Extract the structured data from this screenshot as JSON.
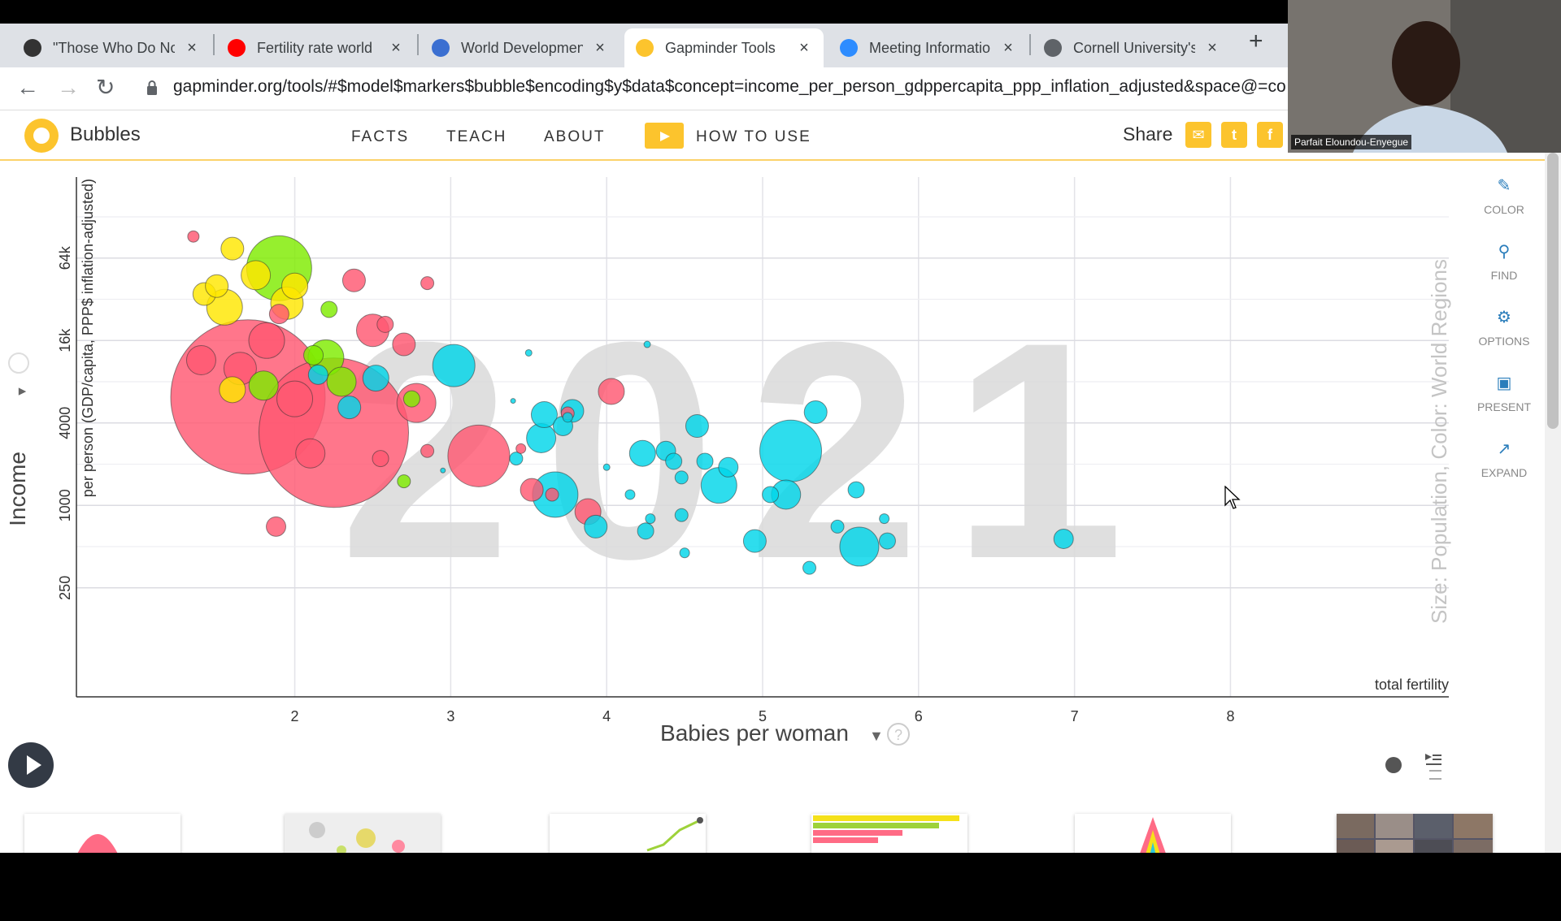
{
  "browser": {
    "tabs": [
      {
        "title": "\"Those Who Do No",
        "favicon": "document-icon",
        "color": "#333333"
      },
      {
        "title": "Fertility rate world",
        "favicon": "youtube-icon",
        "color": "#ff0000"
      },
      {
        "title": "World Developmen",
        "favicon": "globe-icon",
        "color": "#3b6fd1"
      },
      {
        "title": "Gapminder Tools",
        "favicon": "gapminder-icon",
        "color": "#fcc42d"
      },
      {
        "title": "Meeting Informatio",
        "favicon": "zoom-icon",
        "color": "#2d8cff"
      },
      {
        "title": "Cornell University's",
        "favicon": "globe-icon",
        "color": "#5f6368"
      }
    ],
    "active_tab": 3,
    "url": "gapminder.org/tools/#$model$markers$bubble$encoding$y$data$concept=income_per_person_gdppercapita_ppp_inflation_adjusted&space@=co"
  },
  "app": {
    "name": "Bubbles",
    "menu": [
      "FACTS",
      "TEACH",
      "ABOUT"
    ],
    "how_to_use": "HOW TO USE",
    "share": "Share",
    "brand_color": "#fcc42d"
  },
  "video": {
    "participant": "Parfait Eloundou-Enyegue"
  },
  "tools": [
    "COLOR",
    "FIND",
    "OPTIONS",
    "PRESENT",
    "EXPAND"
  ],
  "chart_data": {
    "type": "scatter",
    "year": "2021",
    "xlabel": "Babies per woman",
    "xlabel_corner": "total fertility",
    "ylabel": "Income",
    "ylabel_sub": "per person (GDP/capita, PPP$ inflation-adjusted)",
    "size_color_label": "Size: Population, Color: World Regions",
    "x_ticks": [
      2,
      3,
      4,
      5,
      6,
      7,
      8
    ],
    "y_ticks": [
      {
        "label": "250",
        "value": 250
      },
      {
        "label": "1000",
        "value": 1000
      },
      {
        "label": "4000",
        "value": 4000
      },
      {
        "label": "16k",
        "value": 16000
      },
      {
        "label": "64k",
        "value": 64000
      }
    ],
    "xlim": [
      0.6,
      9.4
    ],
    "ylim": [
      40,
      250000
    ],
    "y_scale": "log",
    "grid": true,
    "colors": {
      "asia": "#ff5872",
      "africa": "#00d5e9",
      "americas": "#7feb00",
      "europe": "#ffe700"
    },
    "points": [
      {
        "x": 1.7,
        "y": 6200,
        "r": 95,
        "region": "asia"
      },
      {
        "x": 2.25,
        "y": 3400,
        "r": 92,
        "region": "asia"
      },
      {
        "x": 5.18,
        "y": 2500,
        "r": 38,
        "region": "africa"
      },
      {
        "x": 1.9,
        "y": 54000,
        "r": 40,
        "region": "americas"
      },
      {
        "x": 3.18,
        "y": 2300,
        "r": 38,
        "region": "asia"
      },
      {
        "x": 3.02,
        "y": 10500,
        "r": 26,
        "region": "africa"
      },
      {
        "x": 3.67,
        "y": 1200,
        "r": 28,
        "region": "africa"
      },
      {
        "x": 4.72,
        "y": 1400,
        "r": 22,
        "region": "africa"
      },
      {
        "x": 5.62,
        "y": 500,
        "r": 24,
        "region": "africa"
      },
      {
        "x": 2.78,
        "y": 5600,
        "r": 24,
        "region": "asia"
      },
      {
        "x": 1.55,
        "y": 28000,
        "r": 22,
        "region": "europe"
      },
      {
        "x": 1.82,
        "y": 16000,
        "r": 22,
        "region": "asia"
      },
      {
        "x": 2.5,
        "y": 19000,
        "r": 20,
        "region": "asia"
      },
      {
        "x": 1.95,
        "y": 30000,
        "r": 20,
        "region": "europe"
      },
      {
        "x": 2.2,
        "y": 12000,
        "r": 22,
        "region": "americas"
      },
      {
        "x": 2.0,
        "y": 6000,
        "r": 22,
        "region": "asia"
      },
      {
        "x": 2.1,
        "y": 2400,
        "r": 18,
        "region": "asia"
      },
      {
        "x": 1.65,
        "y": 10000,
        "r": 20,
        "region": "asia"
      },
      {
        "x": 1.4,
        "y": 11500,
        "r": 18,
        "region": "asia"
      },
      {
        "x": 2.3,
        "y": 8000,
        "r": 18,
        "region": "americas"
      },
      {
        "x": 2.52,
        "y": 8500,
        "r": 16,
        "region": "africa"
      },
      {
        "x": 2.7,
        "y": 15000,
        "r": 14,
        "region": "asia"
      },
      {
        "x": 2.38,
        "y": 44000,
        "r": 14,
        "region": "asia"
      },
      {
        "x": 2.58,
        "y": 21000,
        "r": 10,
        "region": "asia"
      },
      {
        "x": 2.85,
        "y": 42000,
        "r": 8,
        "region": "asia"
      },
      {
        "x": 1.35,
        "y": 92000,
        "r": 7,
        "region": "asia"
      },
      {
        "x": 1.6,
        "y": 75000,
        "r": 14,
        "region": "europe"
      },
      {
        "x": 1.75,
        "y": 48000,
        "r": 18,
        "region": "europe"
      },
      {
        "x": 2.0,
        "y": 40000,
        "r": 16,
        "region": "europe"
      },
      {
        "x": 1.42,
        "y": 35000,
        "r": 14,
        "region": "europe"
      },
      {
        "x": 1.6,
        "y": 7000,
        "r": 16,
        "region": "europe"
      },
      {
        "x": 1.8,
        "y": 7500,
        "r": 18,
        "region": "americas"
      },
      {
        "x": 2.12,
        "y": 12500,
        "r": 12,
        "region": "americas"
      },
      {
        "x": 1.5,
        "y": 40000,
        "r": 14,
        "region": "europe"
      },
      {
        "x": 2.22,
        "y": 27000,
        "r": 10,
        "region": "americas"
      },
      {
        "x": 2.15,
        "y": 9000,
        "r": 12,
        "region": "africa"
      },
      {
        "x": 2.35,
        "y": 5200,
        "r": 14,
        "region": "africa"
      },
      {
        "x": 1.9,
        "y": 25000,
        "r": 12,
        "region": "asia"
      },
      {
        "x": 2.75,
        "y": 6000,
        "r": 10,
        "region": "americas"
      },
      {
        "x": 2.55,
        "y": 2200,
        "r": 10,
        "region": "asia"
      },
      {
        "x": 2.85,
        "y": 2500,
        "r": 8,
        "region": "asia"
      },
      {
        "x": 2.7,
        "y": 1500,
        "r": 8,
        "region": "americas"
      },
      {
        "x": 1.88,
        "y": 700,
        "r": 12,
        "region": "asia"
      },
      {
        "x": 3.42,
        "y": 2200,
        "r": 8,
        "region": "africa"
      },
      {
        "x": 3.5,
        "y": 13000,
        "r": 4,
        "region": "africa"
      },
      {
        "x": 3.58,
        "y": 3100,
        "r": 18,
        "region": "africa"
      },
      {
        "x": 3.72,
        "y": 3800,
        "r": 12,
        "region": "africa"
      },
      {
        "x": 3.52,
        "y": 1300,
        "r": 14,
        "region": "asia"
      },
      {
        "x": 3.88,
        "y": 900,
        "r": 16,
        "region": "asia"
      },
      {
        "x": 3.93,
        "y": 700,
        "r": 14,
        "region": "africa"
      },
      {
        "x": 4.03,
        "y": 6800,
        "r": 16,
        "region": "asia"
      },
      {
        "x": 4.23,
        "y": 2400,
        "r": 16,
        "region": "africa"
      },
      {
        "x": 4.38,
        "y": 2500,
        "r": 12,
        "region": "africa"
      },
      {
        "x": 4.43,
        "y": 2100,
        "r": 10,
        "region": "africa"
      },
      {
        "x": 4.58,
        "y": 3800,
        "r": 14,
        "region": "africa"
      },
      {
        "x": 4.63,
        "y": 2100,
        "r": 10,
        "region": "africa"
      },
      {
        "x": 4.48,
        "y": 1600,
        "r": 8,
        "region": "africa"
      },
      {
        "x": 4.48,
        "y": 850,
        "r": 8,
        "region": "africa"
      },
      {
        "x": 4.25,
        "y": 650,
        "r": 10,
        "region": "africa"
      },
      {
        "x": 4.15,
        "y": 1200,
        "r": 6,
        "region": "africa"
      },
      {
        "x": 4.0,
        "y": 1900,
        "r": 4,
        "region": "africa"
      },
      {
        "x": 4.28,
        "y": 800,
        "r": 6,
        "region": "africa"
      },
      {
        "x": 4.26,
        "y": 15000,
        "r": 4,
        "region": "africa"
      },
      {
        "x": 4.5,
        "y": 450,
        "r": 6,
        "region": "africa"
      },
      {
        "x": 5.05,
        "y": 1200,
        "r": 10,
        "region": "africa"
      },
      {
        "x": 4.95,
        "y": 550,
        "r": 14,
        "region": "africa"
      },
      {
        "x": 5.15,
        "y": 1200,
        "r": 18,
        "region": "africa"
      },
      {
        "x": 5.34,
        "y": 4800,
        "r": 14,
        "region": "africa"
      },
      {
        "x": 4.78,
        "y": 1900,
        "r": 12,
        "region": "africa"
      },
      {
        "x": 5.48,
        "y": 700,
        "r": 8,
        "region": "africa"
      },
      {
        "x": 5.6,
        "y": 1300,
        "r": 10,
        "region": "africa"
      },
      {
        "x": 5.8,
        "y": 550,
        "r": 10,
        "region": "africa"
      },
      {
        "x": 5.3,
        "y": 350,
        "r": 8,
        "region": "africa"
      },
      {
        "x": 5.78,
        "y": 800,
        "r": 6,
        "region": "africa"
      },
      {
        "x": 6.93,
        "y": 570,
        "r": 12,
        "region": "africa"
      },
      {
        "x": 3.6,
        "y": 4600,
        "r": 16,
        "region": "africa"
      },
      {
        "x": 3.78,
        "y": 4900,
        "r": 14,
        "region": "africa"
      },
      {
        "x": 3.75,
        "y": 4700,
        "r": 8,
        "region": "asia"
      },
      {
        "x": 3.75,
        "y": 4400,
        "r": 6,
        "region": "africa"
      },
      {
        "x": 3.65,
        "y": 1200,
        "r": 8,
        "region": "asia"
      },
      {
        "x": 3.45,
        "y": 2600,
        "r": 6,
        "region": "asia"
      },
      {
        "x": 3.4,
        "y": 5800,
        "r": 3,
        "region": "africa"
      },
      {
        "x": 2.95,
        "y": 1800,
        "r": 3,
        "region": "africa"
      }
    ]
  }
}
